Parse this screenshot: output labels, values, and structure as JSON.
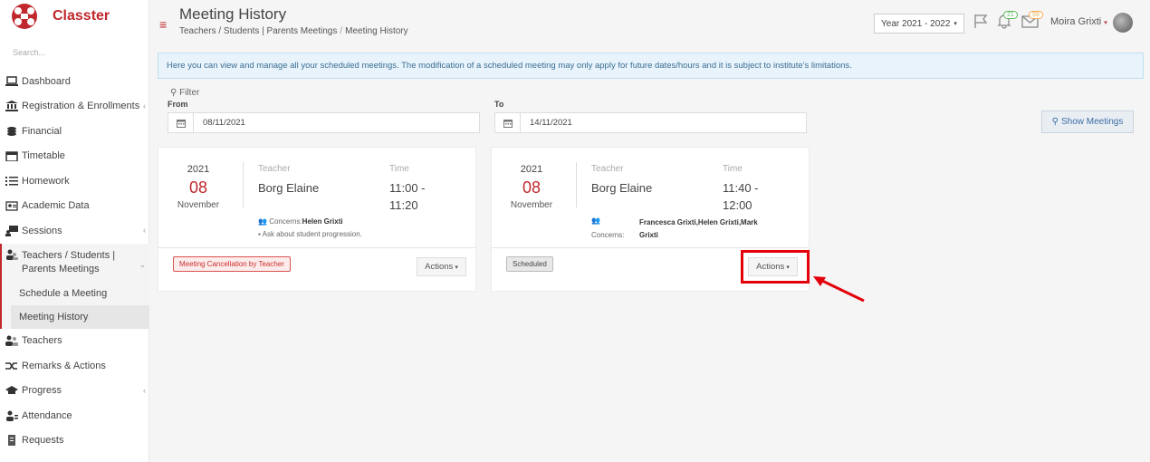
{
  "brand": {
    "name": "Classter"
  },
  "search": {
    "placeholder": "Search..."
  },
  "sidebar": {
    "items": [
      {
        "label": "Dashboard",
        "icon": "laptop-icon"
      },
      {
        "label": "Registration & Enrollments",
        "icon": "bank-icon",
        "chevron": true
      },
      {
        "label": "Financial",
        "icon": "coins-icon"
      },
      {
        "label": "Timetable",
        "icon": "calendar-icon"
      },
      {
        "label": "Homework",
        "icon": "list-icon"
      },
      {
        "label": "Academic Data",
        "icon": "id-card-icon"
      },
      {
        "label": "Sessions",
        "icon": "users-board-icon",
        "chevron": true
      }
    ],
    "open_item": {
      "label": "Teachers / Students | Parents Meetings",
      "icon": "user-group-icon"
    },
    "sub_items": [
      {
        "label": "Schedule a Meeting"
      },
      {
        "label": "Meeting History"
      }
    ],
    "items_after": [
      {
        "label": "Teachers",
        "icon": "teachers-icon"
      },
      {
        "label": "Remarks & Actions",
        "icon": "shuffle-icon"
      },
      {
        "label": "Progress",
        "icon": "graduation-cap-icon",
        "chevron": true
      },
      {
        "label": "Attendance",
        "icon": "attendance-icon"
      },
      {
        "label": "Requests",
        "icon": "document-icon"
      }
    ]
  },
  "header": {
    "title": "Meeting History",
    "breadcrumb": [
      "Teachers / Students | Parents Meetings",
      "Meeting History"
    ],
    "year_select": "Year 2021 - 2022",
    "notifications_count": "21",
    "messages_count": "59",
    "user_name": "Moira Grixti"
  },
  "alert": {
    "text": "Here you can view and manage all your scheduled meetings. The modification of a scheduled meeting may only apply for future dates/hours and it is subject to institute's limitations."
  },
  "filter": {
    "label": "Filter",
    "from_label": "From",
    "from_value": "08/11/2021",
    "to_label": "To",
    "to_value": "14/11/2021",
    "show_button": "Show Meetings"
  },
  "meetings": [
    {
      "year": "2021",
      "day": "08",
      "month": "November",
      "teacher_label": "Teacher",
      "teacher": "Borg Elaine",
      "time_label": "Time",
      "time_line1": "11:00 -",
      "time_line2": "11:20",
      "concerns_label": "Concerns:",
      "concerns": "Helen Grixti",
      "note": "Ask about student progression.",
      "status": "Meeting Cancellation by Teacher",
      "actions": "Actions"
    },
    {
      "year": "2021",
      "day": "08",
      "month": "November",
      "teacher_label": "Teacher",
      "teacher": "Borg Elaine",
      "time_label": "Time",
      "time_line1": "11:40 -",
      "time_line2": "12:00",
      "concerns_label": "Concerns:",
      "concerns_line1": "Francesca Grixti,Helen Grixti,Mark",
      "concerns_line2": "Grixti",
      "status": "Scheduled",
      "actions": "Actions"
    }
  ],
  "colors": {
    "brand": "#c0282d",
    "highlight": "#e3000b"
  }
}
